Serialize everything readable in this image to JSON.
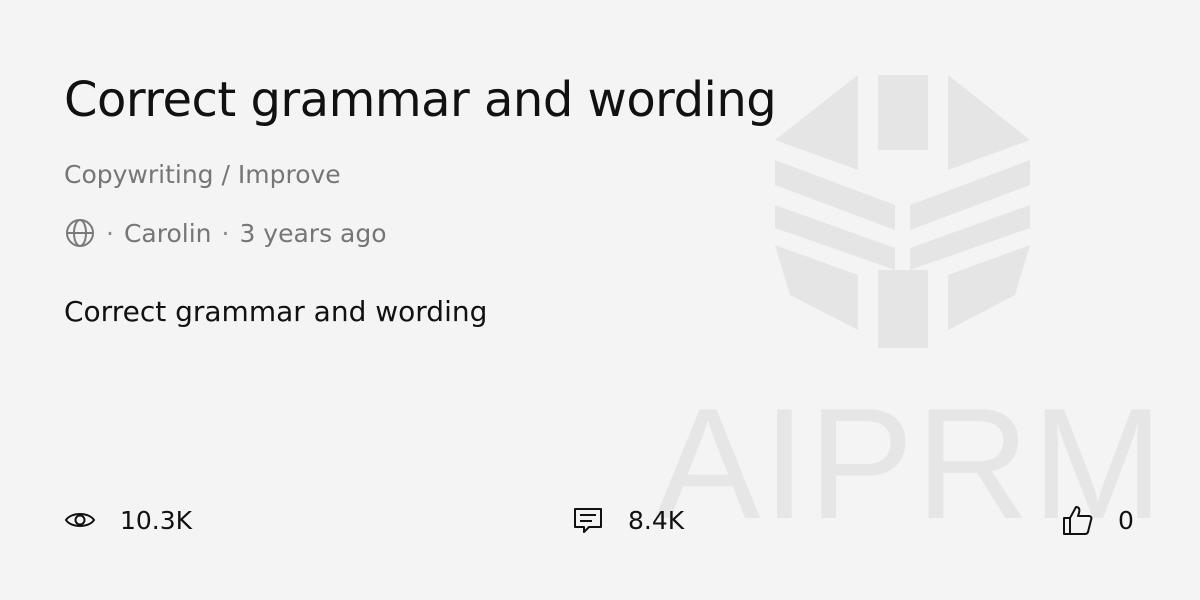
{
  "prompt": {
    "title": "Correct grammar and wording",
    "category": "Copywriting / Improve",
    "visibility_icon": "globe-icon",
    "author": "Carolin",
    "separator": "·",
    "age": "3 years ago",
    "description": "Correct grammar and wording"
  },
  "stats": {
    "views": {
      "icon": "eye-icon",
      "value": "10.3K"
    },
    "comments": {
      "icon": "comment-icon",
      "value": "8.4K"
    },
    "likes": {
      "icon": "thumbs-up-icon",
      "value": "0"
    }
  },
  "watermark": {
    "text": "AIPRM",
    "color": "#e4e4e4"
  },
  "colors": {
    "background": "#f4f4f4",
    "title": "#111111",
    "muted": "#767676"
  }
}
